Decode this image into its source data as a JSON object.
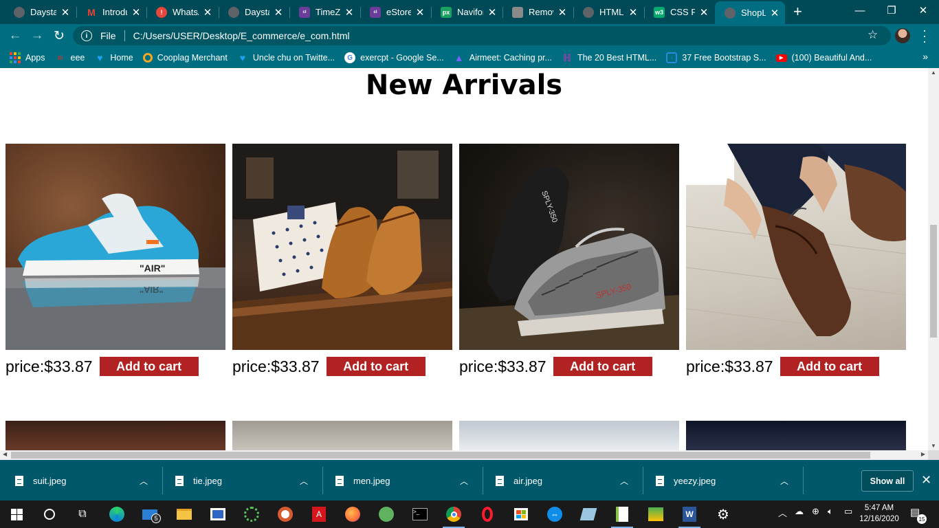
{
  "browser": {
    "tabs": [
      {
        "title": "Daystar",
        "icon": "globe-icon",
        "color": "#5f6368"
      },
      {
        "title": "Introdu",
        "icon": "gmail-icon",
        "color": "#ea4335"
      },
      {
        "title": "WhatsA",
        "icon": "whatsapp-alert-icon",
        "color": "#e8453c"
      },
      {
        "title": "Daystar",
        "icon": "globe-icon",
        "color": "#5f6368"
      },
      {
        "title": "TimeZo",
        "icon": "colorlib-icon",
        "color": "#6a3d9a"
      },
      {
        "title": "eStore",
        "icon": "colorlib-icon",
        "color": "#6a3d9a"
      },
      {
        "title": "Navifor",
        "icon": "px-icon",
        "color": "#1aa260"
      },
      {
        "title": "Remove",
        "icon": "stack-icon",
        "color": "#8a8a8a"
      },
      {
        "title": "HTML C",
        "icon": "globe-icon",
        "color": "#5f6368"
      },
      {
        "title": "CSS For",
        "icon": "w3-icon",
        "color": "#04aa6d"
      },
      {
        "title": "ShopLi",
        "icon": "globe-icon",
        "color": "#5f6368"
      }
    ],
    "address": {
      "scheme": "File",
      "url": "C:/Users/USER/Desktop/E_commerce/e_com.html"
    },
    "bookmarks": [
      {
        "label": "Apps",
        "icon": "apps-grid-icon",
        "color": "#e8a33d"
      },
      {
        "label": "eee",
        "icon": "bookmark-icon",
        "color": "#c0392b"
      },
      {
        "label": "Home",
        "icon": "twitter-icon",
        "color": "#1da1f2"
      },
      {
        "label": "Cooplag Merchant",
        "icon": "cooplag-icon",
        "color": "#f5a623"
      },
      {
        "label": "Uncle chu on Twitte...",
        "icon": "twitter-icon",
        "color": "#1da1f2"
      },
      {
        "label": "exercpt - Google Se...",
        "icon": "google-icon",
        "color": "#ffffff"
      },
      {
        "label": "Airmeet: Caching pr...",
        "icon": "airmeet-icon",
        "color": "#7b61ff"
      },
      {
        "label": "The 20 Best HTML...",
        "icon": "hackernoon-icon",
        "color": "#8e44ad"
      },
      {
        "label": "37 Free Bootstrap S...",
        "icon": "bootstrap-icon",
        "color": "#2e86de"
      },
      {
        "label": "(100) Beautiful And...",
        "icon": "youtube-icon",
        "color": "#ff0000"
      }
    ]
  },
  "page": {
    "heading": "New Arrivals",
    "products": [
      {
        "price": "price:$33.87",
        "button": "Add to cart",
        "image": "air-sneaker"
      },
      {
        "price": "price:$33.87",
        "button": "Add to cart",
        "image": "brogues-shirts"
      },
      {
        "price": "price:$33.87",
        "button": "Add to cart",
        "image": "yeezy-sneaker"
      },
      {
        "price": "price:$33.87",
        "button": "Add to cart",
        "image": "man-tying-shoe"
      }
    ],
    "accent_color": "#b22222"
  },
  "downloads": {
    "items": [
      "suit.jpeg",
      "tie.jpeg",
      "men.jpeg",
      "air.jpeg",
      "yeezy.jpeg"
    ],
    "show_all": "Show all"
  },
  "taskbar": {
    "mail_badge": "5",
    "time": "5:47 AM",
    "date": "12/16/2020",
    "notification_count": "15"
  }
}
